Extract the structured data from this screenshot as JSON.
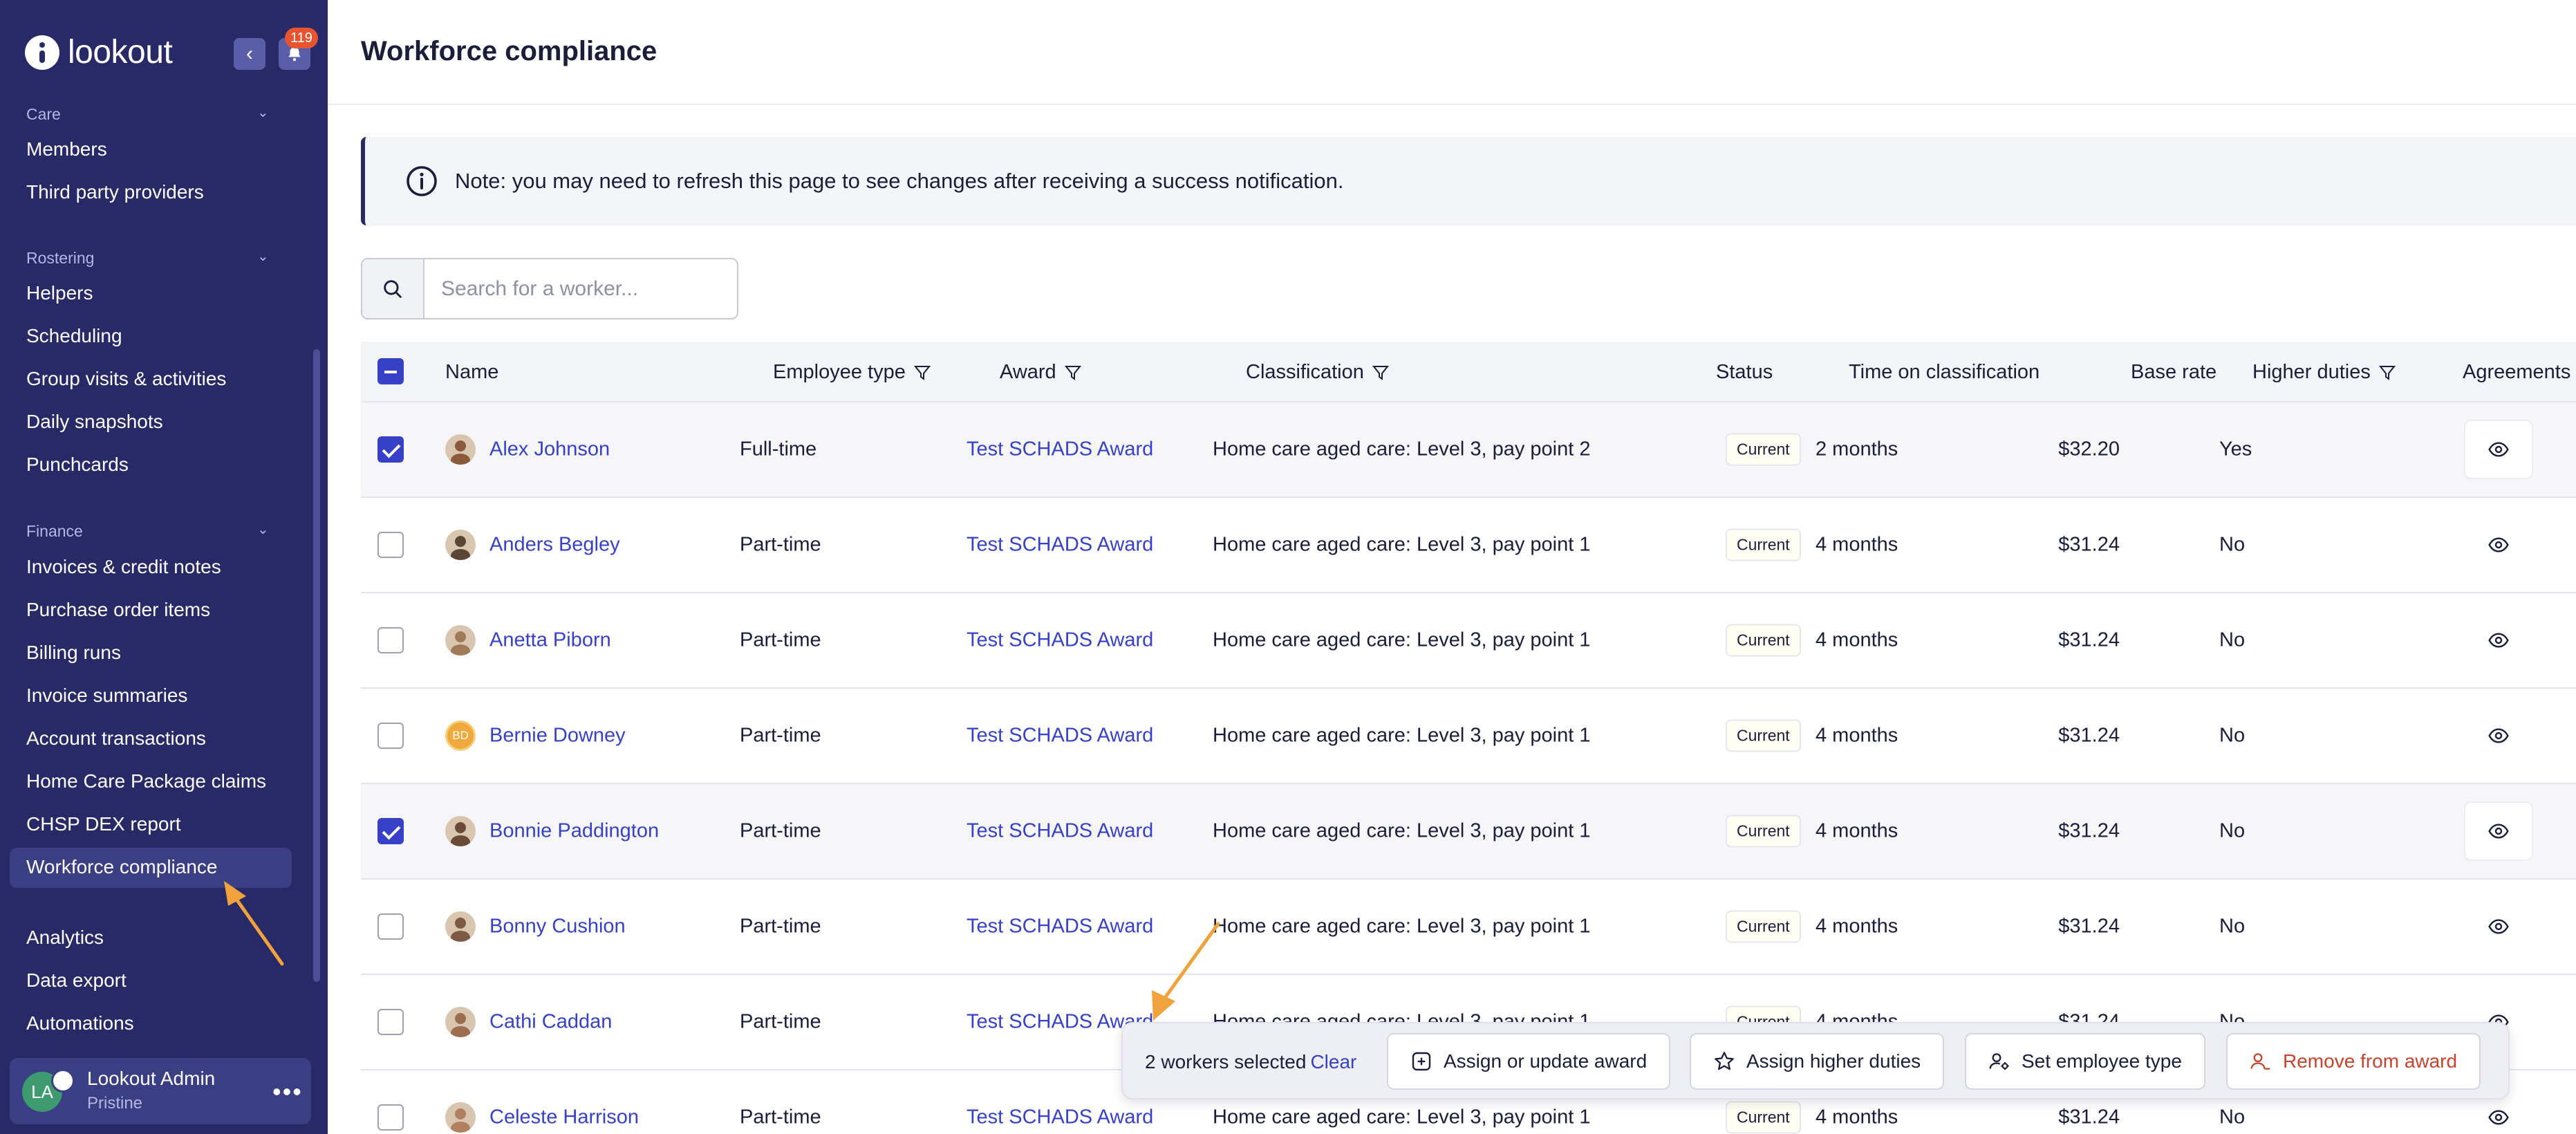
{
  "app": {
    "logo_text": "lookout",
    "notifications_count": "119"
  },
  "sidebar": {
    "sections": [
      {
        "label": "Care",
        "items": [
          "Members",
          "Third party providers"
        ]
      },
      {
        "label": "Rostering",
        "items": [
          "Helpers",
          "Scheduling",
          "Group visits & activities",
          "Daily snapshots",
          "Punchcards"
        ]
      },
      {
        "label": "Finance",
        "items": [
          "Invoices & credit notes",
          "Purchase order items",
          "Billing runs",
          "Invoice summaries",
          "Account transactions",
          "Home Care Package claims",
          "CHSP DEX report",
          "Workforce compliance"
        ]
      }
    ],
    "other_items": [
      "Analytics",
      "Data export",
      "Automations"
    ],
    "active_item": "Workforce compliance",
    "user": {
      "initials": "LA",
      "name": "Lookout Admin",
      "org": "Pristine"
    }
  },
  "page": {
    "title": "Workforce compliance",
    "note": "Note: you may need to refresh this page to see changes after receiving a success notification.",
    "search_placeholder": "Search for a worker..."
  },
  "table": {
    "columns": [
      "Name",
      "Employee type",
      "Award",
      "Classification",
      "Status",
      "Time on classification",
      "Base rate",
      "Higher duties",
      "Agreements"
    ],
    "rows": [
      {
        "name": "Alex Johnson",
        "employee_type": "Full-time",
        "award": "Test SCHADS Award",
        "classification": "Home care aged care: Level 3, pay point 2",
        "status": "Current",
        "time_on_classification": "2 months",
        "base_rate": "$32.20",
        "higher_duties": "Yes",
        "selected": true,
        "avatar": "photo",
        "avatar_color": "#8b5a3c"
      },
      {
        "name": "Anders Begley",
        "employee_type": "Part-time",
        "award": "Test SCHADS Award",
        "classification": "Home care aged care: Level 3, pay point 1",
        "status": "Current",
        "time_on_classification": "4 months",
        "base_rate": "$31.24",
        "higher_duties": "No",
        "selected": false,
        "avatar": "photo",
        "avatar_color": "#5b4636"
      },
      {
        "name": "Anetta Piborn",
        "employee_type": "Part-time",
        "award": "Test SCHADS Award",
        "classification": "Home care aged care: Level 3, pay point 1",
        "status": "Current",
        "time_on_classification": "4 months",
        "base_rate": "$31.24",
        "higher_duties": "No",
        "selected": false,
        "avatar": "photo",
        "avatar_color": "#a0785a"
      },
      {
        "name": "Bernie Downey",
        "employee_type": "Part-time",
        "award": "Test SCHADS Award",
        "classification": "Home care aged care: Level 3, pay point 1",
        "status": "Current",
        "time_on_classification": "4 months",
        "base_rate": "$31.24",
        "higher_duties": "No",
        "selected": false,
        "avatar": "initials",
        "initials": "BD",
        "avatar_color": "#f0a93b"
      },
      {
        "name": "Bonnie Paddington",
        "employee_type": "Part-time",
        "award": "Test SCHADS Award",
        "classification": "Home care aged care: Level 3, pay point 1",
        "status": "Current",
        "time_on_classification": "4 months",
        "base_rate": "$31.24",
        "higher_duties": "No",
        "selected": true,
        "avatar": "photo",
        "avatar_color": "#6a4b38"
      },
      {
        "name": "Bonny Cushion",
        "employee_type": "Part-time",
        "award": "Test SCHADS Award",
        "classification": "Home care aged care: Level 3, pay point 1",
        "status": "Current",
        "time_on_classification": "4 months",
        "base_rate": "$31.24",
        "higher_duties": "No",
        "selected": false,
        "avatar": "photo",
        "avatar_color": "#7d5a44"
      },
      {
        "name": "Cathi Caddan",
        "employee_type": "Part-time",
        "award": "Test SCHADS Award",
        "classification": "Home care aged care: Level 3, pay point 1",
        "status": "Current",
        "time_on_classification": "4 months",
        "base_rate": "$31.24",
        "higher_duties": "No",
        "selected": false,
        "avatar": "photo",
        "avatar_color": "#9c6e4f"
      },
      {
        "name": "Celeste Harrison",
        "employee_type": "Part-time",
        "award": "Test SCHADS Award",
        "classification": "Home care aged care: Level 3, pay point 1",
        "status": "Current",
        "time_on_classification": "4 months",
        "base_rate": "$31.24",
        "higher_duties": "No",
        "selected": false,
        "avatar": "photo",
        "avatar_color": "#b08060"
      }
    ]
  },
  "bulk_bar": {
    "selected_text": "2 workers selected",
    "clear_label": "Clear",
    "actions": [
      "Assign or update award",
      "Assign higher duties",
      "Set employee type",
      "Remove from award"
    ]
  },
  "colors": {
    "sidebar": "#272a66",
    "link": "#3641c7",
    "danger": "#c8432e",
    "annotation_arrow": "#f0a23c"
  },
  "icons": [
    "chevron-left-icon",
    "bell-icon",
    "chevron-down-icon",
    "info-icon",
    "search-icon",
    "filter-icon",
    "eye-icon",
    "plus-square-icon",
    "star-icon",
    "user-gear-icon",
    "user-remove-icon",
    "more-icon"
  ]
}
